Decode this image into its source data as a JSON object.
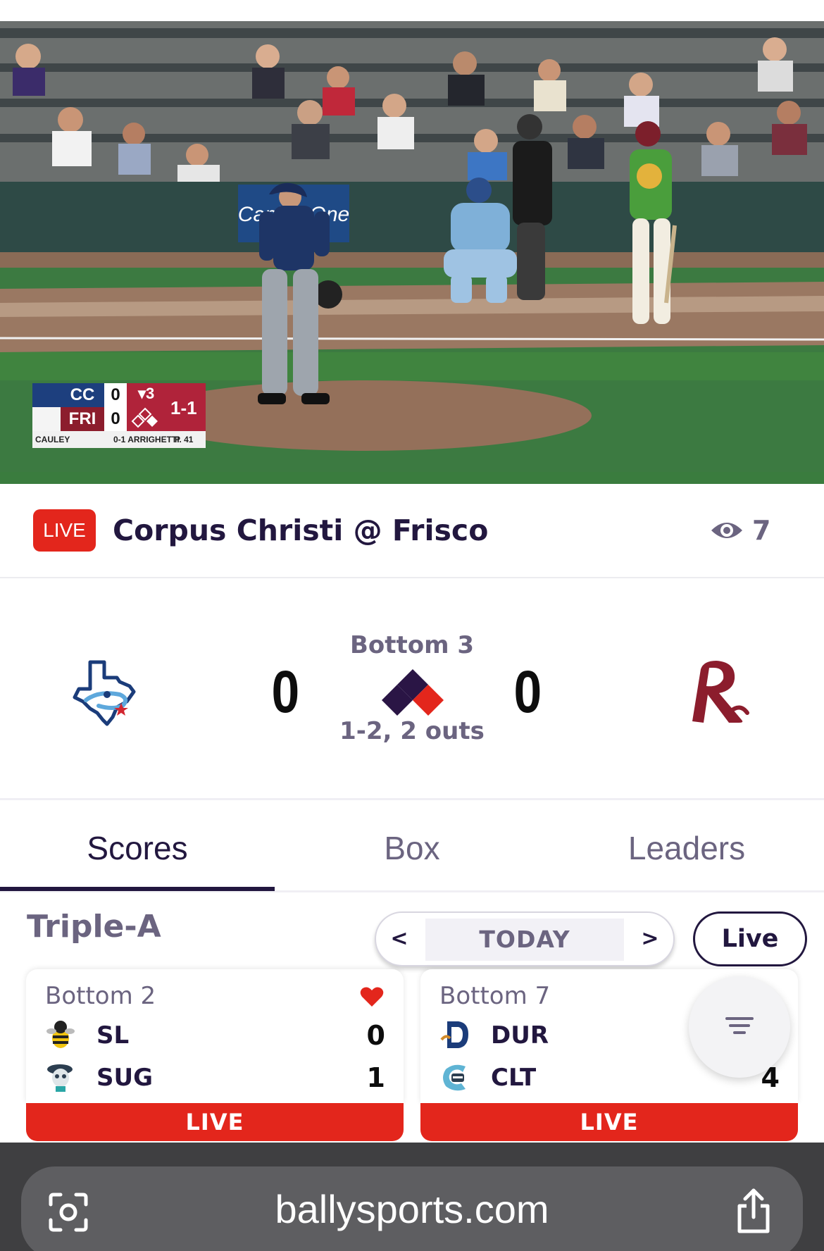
{
  "video": {
    "scorebug": {
      "away_abbr": "CC",
      "away_score": "0",
      "home_abbr": "FRI",
      "home_score": "0",
      "inning": "▾3",
      "count": "1-1",
      "pitcher": "CAULEY",
      "batter_line": "0-1 ARRIGHETTI",
      "pitch_count": "P. 41"
    },
    "banner_text": "Capital One"
  },
  "header": {
    "live_label": "LIVE",
    "matchup": "Corpus Christi @ Frisco",
    "viewer_count": "7",
    "viewer_icon": "eye-icon"
  },
  "game": {
    "away_score": "0",
    "home_score": "0",
    "inning": "Bottom 3",
    "count_outs": "1-2, 2 outs",
    "bases": {
      "first": true,
      "second": true,
      "third": false
    },
    "colors": {
      "runner": "#e3261c",
      "base": "#2a1545",
      "home_team": "#8c1d2d",
      "away_team": "#1b3c7a"
    }
  },
  "tabs": [
    {
      "label": "Scores",
      "active": true
    },
    {
      "label": "Box",
      "active": false
    },
    {
      "label": "Leaders",
      "active": false
    }
  ],
  "scores": {
    "league": "Triple-A",
    "date_prev": "<",
    "date_label": "TODAY",
    "date_next": ">",
    "live_filter": "Live",
    "games": [
      {
        "inning": "Bottom 2",
        "favorited": true,
        "teams": [
          {
            "abbr": "SL",
            "score": "0",
            "icon": "bee-icon"
          },
          {
            "abbr": "SUG",
            "score": "1",
            "icon": "sugar-skull-icon"
          }
        ],
        "status": "LIVE"
      },
      {
        "inning": "Bottom 7",
        "favorited": false,
        "teams": [
          {
            "abbr": "DUR",
            "score": "",
            "icon": "bull-icon"
          },
          {
            "abbr": "CLT",
            "score": "4",
            "icon": "knight-icon"
          }
        ],
        "status": "LIVE"
      }
    ]
  },
  "browser": {
    "url": "ballysports.com"
  },
  "theme": {
    "live_red": "#e3261c",
    "navy": "#22173f",
    "muted": "#6b6480"
  }
}
